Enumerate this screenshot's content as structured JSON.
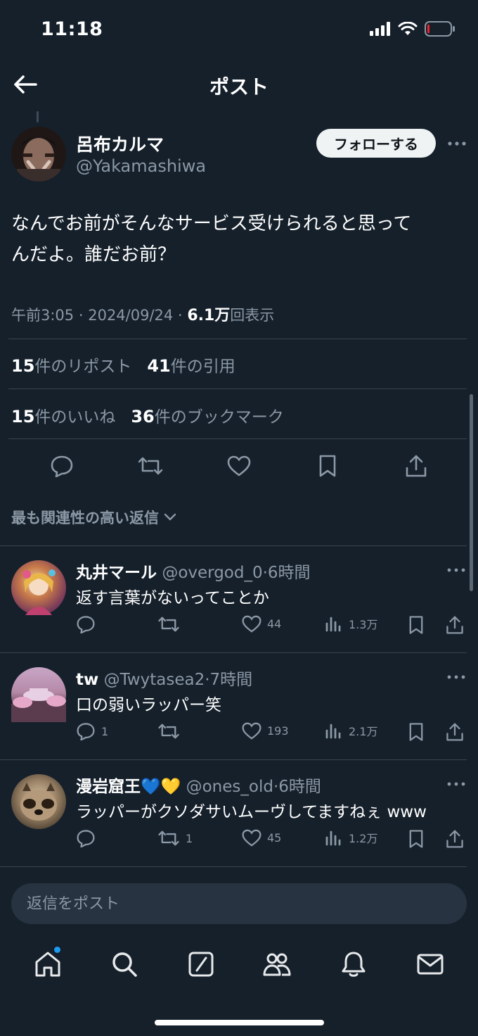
{
  "status_bar": {
    "time": "11:18"
  },
  "header": {
    "title": "ポスト"
  },
  "post": {
    "author_name": "呂布カルマ",
    "author_handle": "@Yakamashiwa",
    "follow_label": "フォローする",
    "text_line1": "なんでお前がそんなサービス受けられると思って",
    "text_line2": "んだよ。誰だお前？",
    "time": "午前3:05",
    "date": "2024/09/24",
    "views_count": "6.1万",
    "views_label": "回表示",
    "reposts_count": "15",
    "reposts_label": "件のリポスト",
    "quotes_count": "41",
    "quotes_label": "件の引用",
    "likes_count": "15",
    "likes_label": "件のいいね",
    "bookmarks_count": "36",
    "bookmarks_label": "件のブックマーク"
  },
  "sort": {
    "label": "最も関連性の高い返信"
  },
  "replies": [
    {
      "name": "丸井マール",
      "handle": "@overgod_0",
      "time": "6時間",
      "text": "返す言葉がないってことか",
      "reply_count": "",
      "repost_count": "",
      "like_count": "44",
      "view_count": "1.3万"
    },
    {
      "name": "tw",
      "handle": "@Twytasea2",
      "time": "7時間",
      "text": "口の弱いラッパー笑",
      "reply_count": "1",
      "repost_count": "",
      "like_count": "193",
      "view_count": "2.1万"
    },
    {
      "name": "漫岩窟王",
      "emoji": "💙💛",
      "handle": "@ones_old",
      "time": "6時間",
      "text": "ラッパーがクソダサいムーヴしてますねぇ www",
      "reply_count": "",
      "repost_count": "1",
      "like_count": "45",
      "view_count": "1.2万"
    }
  ],
  "reply_box": {
    "placeholder": "返信をポスト"
  },
  "colors": {
    "background": "#15202b",
    "accent": "#1d9bf0",
    "muted": "#8b98a5",
    "divider": "#38444d"
  },
  "icons": {
    "nav": [
      "home-icon",
      "search-icon",
      "grok-icon",
      "communities-icon",
      "notifications-icon",
      "messages-icon"
    ],
    "actions": [
      "reply-icon",
      "repost-icon",
      "like-icon",
      "bookmark-icon",
      "share-icon"
    ]
  }
}
